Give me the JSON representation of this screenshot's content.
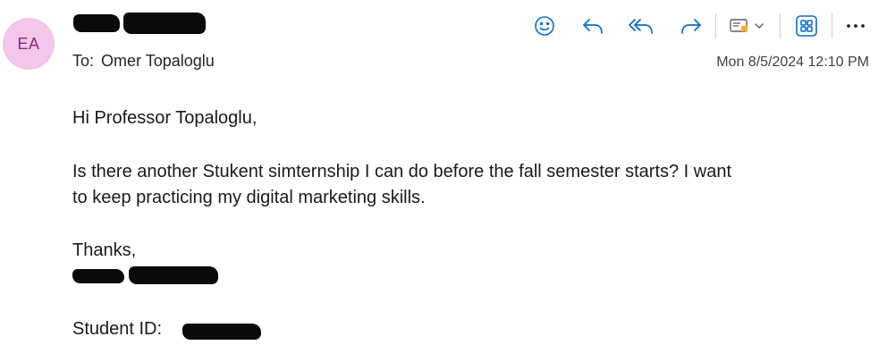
{
  "message": {
    "avatar_initials": "EA",
    "to_label": "To:",
    "recipient": "Omer Topaloglu",
    "date": "Mon 8/5/2024 12:10 PM",
    "body": {
      "greeting": "Hi Professor Topaloglu,",
      "line1": "Is there another Stukent simternship I can do before the fall semester starts? I want",
      "line2": "to keep practicing my digital marketing skills.",
      "closing": "Thanks,",
      "student_id_label": "Student ID:"
    }
  },
  "toolbar": {
    "icons": [
      "smiley-icon",
      "reply-icon",
      "reply-all-icon",
      "forward-icon",
      "tag-icon",
      "chevron-down-icon",
      "apps-icon",
      "more-icon"
    ],
    "accent_color": "#0f6cbd"
  },
  "colors": {
    "avatar_bg": "#f4c6ea",
    "avatar_text": "#8a2a7a"
  }
}
